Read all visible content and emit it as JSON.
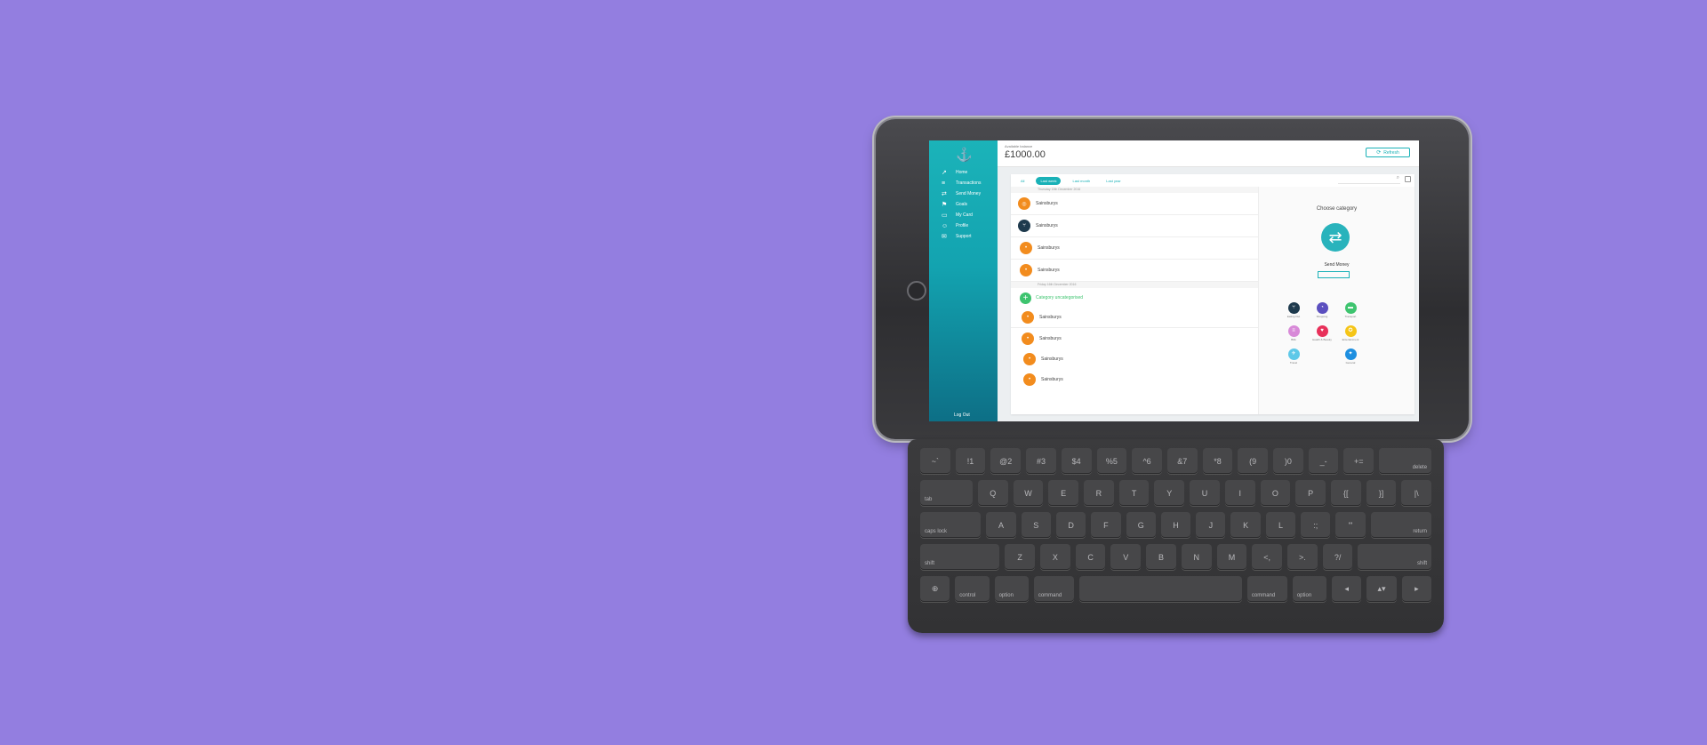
{
  "app": {
    "balance_label": "Available balance",
    "balance_value": "£1000.00",
    "top_button_label": "Refresh",
    "logout": "Log Out",
    "nav": [
      {
        "label": "Home",
        "icon": "chart-line-icon"
      },
      {
        "label": "Transactions",
        "icon": "list-icon"
      },
      {
        "label": "Send Money",
        "icon": "transfer-icon"
      },
      {
        "label": "Goals",
        "icon": "flag-icon"
      },
      {
        "label": "My Card",
        "icon": "card-icon"
      },
      {
        "label": "Profile",
        "icon": "profile-icon"
      },
      {
        "label": "Support",
        "icon": "chat-icon"
      }
    ],
    "filters": [
      "All",
      "Last week",
      "Last month",
      "Last year"
    ],
    "date_header_1": "Thursday 15th December 2016",
    "date_header_2": "Friday 16th December 2016",
    "add_category": "Category uncategorised",
    "transactions_group1": [
      {
        "label": "Sainsburys",
        "color": "#f28c1e"
      },
      {
        "label": "Sainsburys",
        "color": "#1e3a4d"
      },
      {
        "label": "Sainsburys",
        "color": "#f28c1e"
      },
      {
        "label": "Sainsburys",
        "color": "#f28c1e"
      }
    ],
    "transactions_group2": [
      {
        "label": "Sainsburys",
        "color": "#f28c1e"
      },
      {
        "label": "Sainsburys",
        "color": "#f28c1e"
      },
      {
        "label": "Sainsburys",
        "color": "#f28c1e"
      },
      {
        "label": "Sainsburys",
        "color": "#f28c1e"
      }
    ],
    "detail": {
      "title": "Choose category",
      "selected_label": "Send Money",
      "categories": [
        {
          "label": "Eating Out",
          "color": "#1e3a4d"
        },
        {
          "label": "Shopping",
          "color": "#5b4fbf"
        },
        {
          "label": "Transport",
          "color": "#3ec46f"
        },
        {
          "label": "Bills",
          "color": "#d88ad8"
        },
        {
          "label": "Health & Beauty",
          "color": "#e8305a"
        },
        {
          "label": "Entertainment",
          "color": "#f5c518"
        },
        {
          "label": "Travel",
          "color": "#5ec8e8"
        },
        {
          "label": "General",
          "color": "#1e8fe0"
        }
      ]
    }
  },
  "keyboard": {
    "row1": [
      "~`",
      "!1",
      "@2",
      "#3",
      "$4",
      "%5",
      "^6",
      "&7",
      "*8",
      "(9",
      ")0",
      "_-",
      "+=",
      "delete"
    ],
    "row2": [
      "tab",
      "Q",
      "W",
      "E",
      "R",
      "T",
      "Y",
      "U",
      "I",
      "O",
      "P",
      "{[",
      "}]",
      "|\\"
    ],
    "row3": [
      "caps lock",
      "A",
      "S",
      "D",
      "F",
      "G",
      "H",
      "J",
      "K",
      "L",
      ":;",
      "\"'",
      "return"
    ],
    "row4": [
      "shift",
      "Z",
      "X",
      "C",
      "V",
      "B",
      "N",
      "M",
      "<,",
      ">.",
      "?/",
      "shift"
    ],
    "row5": [
      "⊕",
      "control",
      "option",
      "command",
      "",
      "command",
      "option",
      "◂",
      "▴▾",
      "▸"
    ]
  }
}
